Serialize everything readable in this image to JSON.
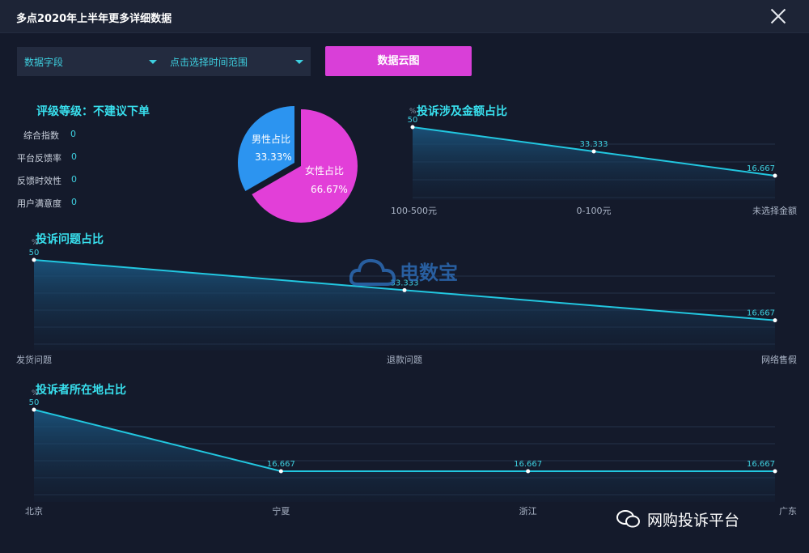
{
  "window": {
    "title": "多点2020年上半年更多详细数据"
  },
  "controls": {
    "field_select": "数据字段",
    "time_select": "点击选择时间范围",
    "cloud_button": "数据云图"
  },
  "rating": {
    "label": "评级等级：不建议下单"
  },
  "stats": [
    {
      "label": "综合指数",
      "value": "0"
    },
    {
      "label": "平台反馈率",
      "value": "0"
    },
    {
      "label": "反馈时效性",
      "value": "0"
    },
    {
      "label": "用户满意度",
      "value": "0"
    }
  ],
  "pie": {
    "male_label": "男性占比",
    "male_value": "33.33%",
    "female_label": "女性占比",
    "female_value": "66.67%",
    "colors": {
      "male": "#2c94f0",
      "female": "#e23fd8"
    }
  },
  "charts": {
    "amount": {
      "title": "投诉涉及金额占比",
      "unit": "%"
    },
    "issue": {
      "title": "投诉问题占比",
      "unit": "%"
    },
    "region": {
      "title": "投诉者所在地占比",
      "unit": "%"
    }
  },
  "watermark": {
    "text": "电数宝"
  },
  "wechat": {
    "text": "网购投诉平台"
  },
  "chart_data": [
    {
      "type": "area",
      "title": "投诉涉及金额占比",
      "categories": [
        "100-500元",
        "0-100元",
        "未选择金额"
      ],
      "values": [
        50,
        33.333,
        16.667
      ],
      "ylabel": "%"
    },
    {
      "type": "area",
      "title": "投诉问题占比",
      "categories": [
        "发货问题",
        "退款问题",
        "网络售假"
      ],
      "values": [
        50,
        33.333,
        16.667
      ],
      "ylabel": "%"
    },
    {
      "type": "area",
      "title": "投诉者所在地占比",
      "categories": [
        "北京",
        "宁夏",
        "浙江",
        "广东"
      ],
      "values": [
        50,
        16.667,
        16.667,
        16.667
      ],
      "ylabel": "%"
    }
  ]
}
